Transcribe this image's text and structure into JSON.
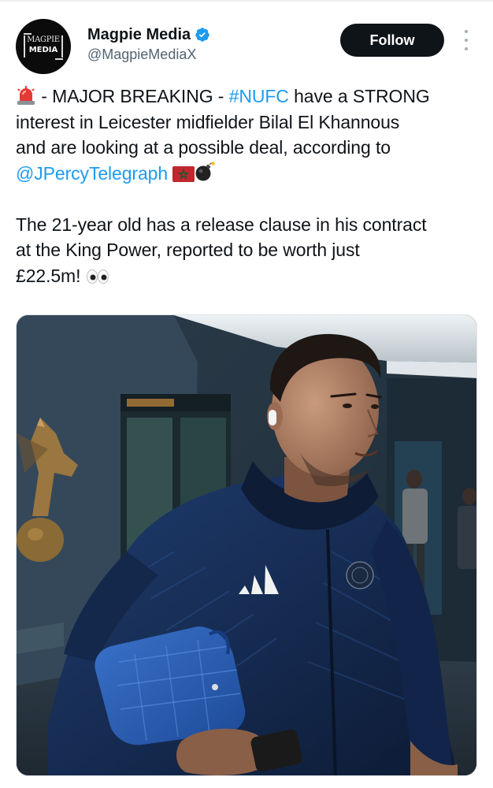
{
  "author": {
    "display_name": "Magpie Media",
    "handle": "@MagpieMediaX",
    "avatar_logo_line1": "MAGPIE",
    "avatar_logo_line2": "MEDIA",
    "verified": true
  },
  "actions": {
    "follow_label": "Follow",
    "more_icon": "more-vertical-icon"
  },
  "tweet": {
    "line1_prefix": " - MAJOR BREAKING - ",
    "line1_hashtag": "#NUFC",
    "line1_suffix": " have a STRONG",
    "line2": "interest in Leicester midfielder Bilal El Khannous",
    "line3": "and are looking at a possible deal, according to",
    "line4_mention": "@JPercyTelegraph",
    "line5": "The 21-year old has a release clause in his contract",
    "line6": "at the King Power, reported to be worth just",
    "line7": "£22.5m! ",
    "emojis": [
      "police-light-icon",
      "morocco-flag-icon",
      "bomb-icon",
      "eyes-icon"
    ]
  },
  "media": {
    "alt": "photo"
  },
  "colors": {
    "link": "#1d9bf0",
    "text": "#0f1419",
    "secondary": "#536471",
    "follow_bg": "#0f1419",
    "verified": "#1d9bf0"
  }
}
